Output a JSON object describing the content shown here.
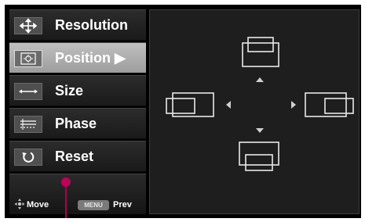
{
  "menu": {
    "items": [
      {
        "label": "Resolution",
        "icon": "move-arrows-icon"
      },
      {
        "label": "Position ▶",
        "icon": "position-square-icon"
      },
      {
        "label": "Size",
        "icon": "horizontal-arrows-icon"
      },
      {
        "label": "Phase",
        "icon": "phase-lines-icon"
      },
      {
        "label": "Reset",
        "icon": "reset-arrow-icon"
      }
    ],
    "active_index": 1
  },
  "help": {
    "move_label": "Move",
    "menu_key": "MENU",
    "prev_label": "Prev"
  },
  "colors": {
    "background": "#000000",
    "accent_marker": "#c0005a",
    "active_item": "#b0b0b0"
  }
}
